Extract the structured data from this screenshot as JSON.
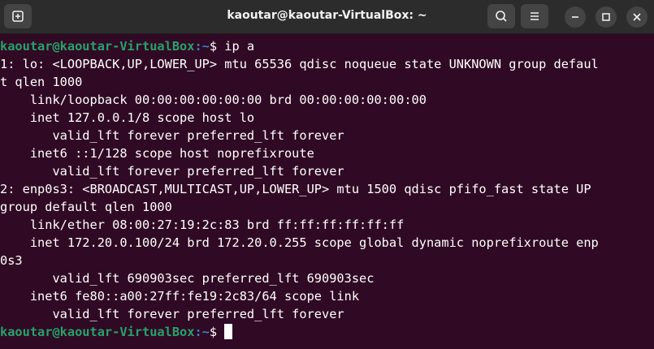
{
  "window": {
    "title": "kaoutar@kaoutar-VirtualBox: ~"
  },
  "icons": {
    "new_tab": "new-tab-icon",
    "search": "search-icon",
    "menu": "hamburger-menu-icon",
    "minimize": "minimize-icon",
    "maximize": "maximize-icon",
    "close": "close-icon"
  },
  "colors": {
    "background": "#300a24",
    "titlebar": "#2c2c2c",
    "prompt_user": "#26a269",
    "prompt_path": "#3d7ec6",
    "text": "#ffffff"
  },
  "terminal": {
    "prompt1": {
      "user_host": "kaoutar@kaoutar-VirtualBox",
      "path": ":~",
      "symbol": "$ ",
      "command": "ip a"
    },
    "output": [
      "1: lo: <LOOPBACK,UP,LOWER_UP> mtu 65536 qdisc noqueue state UNKNOWN group defaul",
      "t qlen 1000",
      "    link/loopback 00:00:00:00:00:00 brd 00:00:00:00:00:00",
      "    inet 127.0.0.1/8 scope host lo",
      "       valid_lft forever preferred_lft forever",
      "    inet6 ::1/128 scope host noprefixroute",
      "       valid_lft forever preferred_lft forever",
      "2: enp0s3: <BROADCAST,MULTICAST,UP,LOWER_UP> mtu 1500 qdisc pfifo_fast state UP",
      "group default qlen 1000",
      "    link/ether 08:00:27:19:2c:83 brd ff:ff:ff:ff:ff:ff",
      "    inet 172.20.0.100/24 brd 172.20.0.255 scope global dynamic noprefixroute enp",
      "0s3",
      "       valid_lft 690903sec preferred_lft 690903sec",
      "    inet6 fe80::a00:27ff:fe19:2c83/64 scope link",
      "       valid_lft forever preferred_lft forever"
    ],
    "prompt2": {
      "user_host": "kaoutar@kaoutar-VirtualBox",
      "path": ":~",
      "symbol": "$ "
    }
  }
}
